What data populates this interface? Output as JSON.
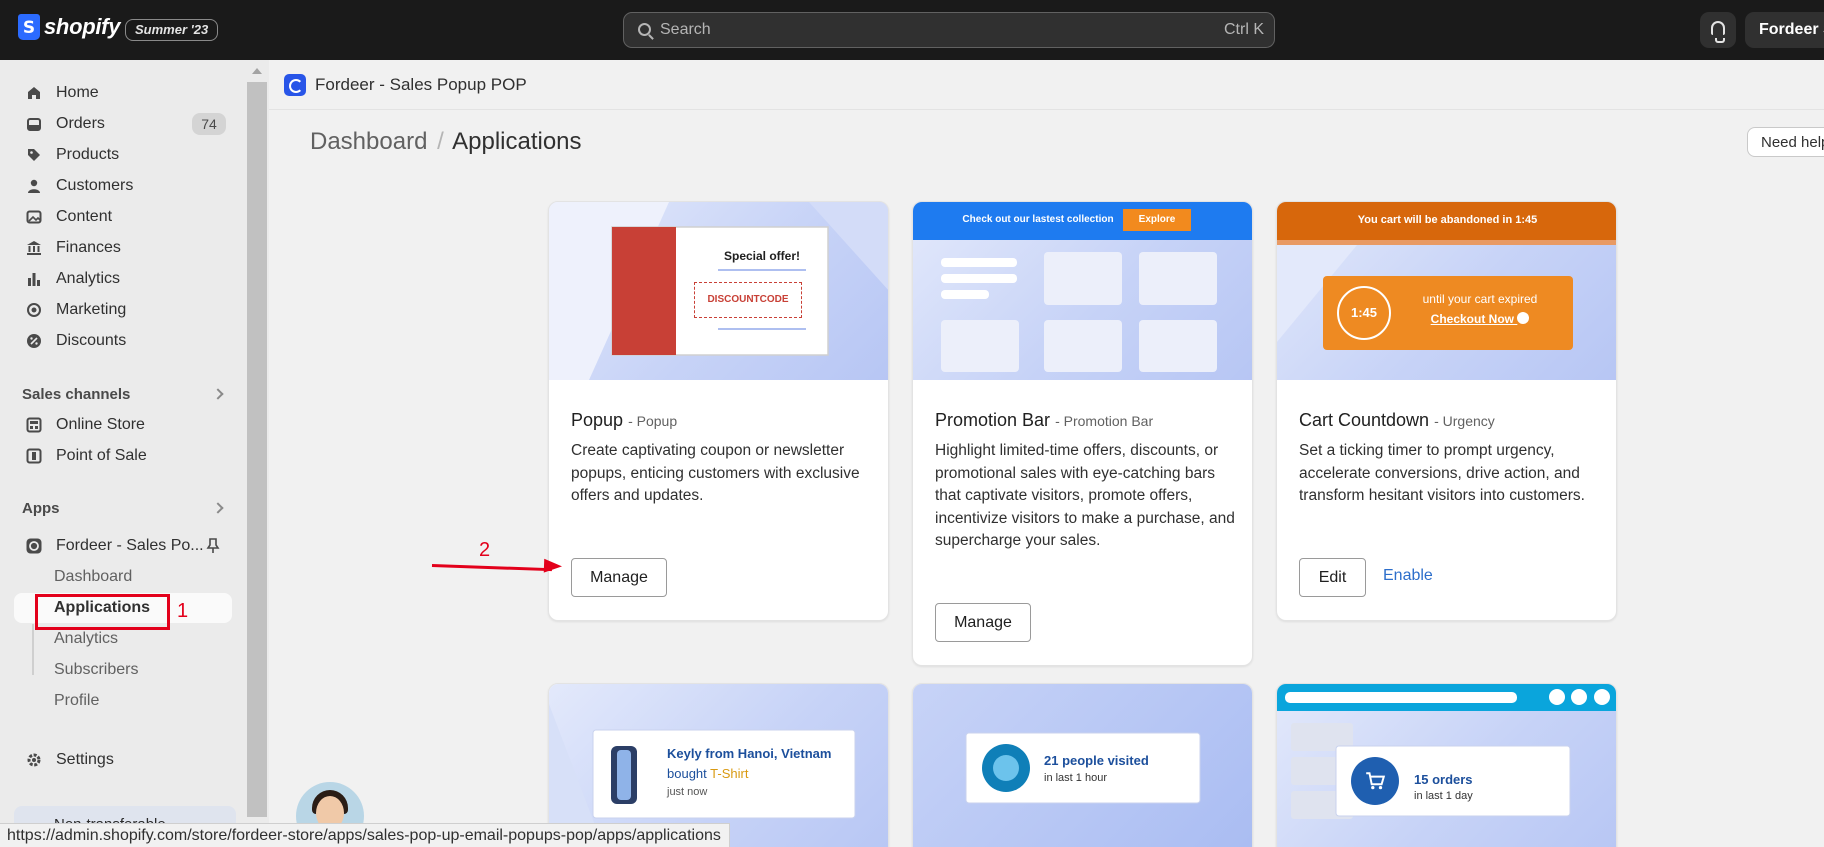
{
  "topbar": {
    "brand": "shopify",
    "brand_mark": "S",
    "edition_badge": "Summer '23",
    "search_placeholder": "Search",
    "search_shortcut": "Ctrl K",
    "store_button": "Fordeer St"
  },
  "sidebar": {
    "items": [
      {
        "label": "Home",
        "icon": "home-icon"
      },
      {
        "label": "Orders",
        "icon": "orders-icon",
        "count": "74"
      },
      {
        "label": "Products",
        "icon": "tag-icon"
      },
      {
        "label": "Customers",
        "icon": "person-icon"
      },
      {
        "label": "Content",
        "icon": "image-icon"
      },
      {
        "label": "Finances",
        "icon": "bank-icon"
      },
      {
        "label": "Analytics",
        "icon": "bar-chart-icon"
      },
      {
        "label": "Marketing",
        "icon": "target-icon"
      },
      {
        "label": "Discounts",
        "icon": "discount-icon"
      }
    ],
    "sales_channels_label": "Sales channels",
    "channels": [
      {
        "label": "Online Store",
        "icon": "store-icon"
      },
      {
        "label": "Point of Sale",
        "icon": "pos-icon"
      }
    ],
    "apps_label": "Apps",
    "app": {
      "label": "Fordeer - Sales Po...",
      "icon": "app-logo-icon"
    },
    "app_subitems": [
      "Dashboard",
      "Applications",
      "Analytics",
      "Subscribers",
      "Profile"
    ],
    "settings_label": "Settings",
    "footer_notice": "Non-transferable"
  },
  "annotations": {
    "marker_1": "1",
    "marker_2": "2"
  },
  "app_header": {
    "title": "Fordeer - Sales Popup POP"
  },
  "main": {
    "breadcrumb_root": "Dashboard",
    "breadcrumb_separator": "/",
    "breadcrumb_current": "Applications",
    "help_button": "Need help"
  },
  "cards": [
    {
      "title": "Popup",
      "tag": "- Popup",
      "description": "Create captivating coupon or newsletter popups, enticing customers with exclusive offers and updates.",
      "primary_button": "Manage",
      "banner": {
        "heading": "Special offer!",
        "code": "DISCOUNTCODE"
      }
    },
    {
      "title": "Promotion Bar",
      "tag": "- Promotion Bar",
      "description": "Highlight limited-time offers, discounts, or promotional sales with eye-catching bars that captivate visitors, promote offers, incentivize visitors to make a purchase, and supercharge your sales.",
      "primary_button": "Manage",
      "banner": {
        "bar_text": "Check out our lastest collection",
        "bar_button": "Explore"
      }
    },
    {
      "title": "Cart Countdown",
      "tag": "- Urgency",
      "description": "Set a ticking timer to prompt urgency, accelerate conversions, drive action, and transform hesitant visitors into customers.",
      "primary_button": "Edit",
      "secondary_link": "Enable",
      "banner": {
        "bar_text": "You cart will be abandoned in 1:45",
        "timer": "1:45",
        "line1": "until your cart expired",
        "cta": "Checkout Now"
      }
    }
  ],
  "preview_cards": [
    {
      "name": "Keyly from Hanoi, Vietnam",
      "action": "bought",
      "product": "T-Shirt",
      "time": "just now"
    },
    {
      "headline": "21 people visited",
      "sub": "in last 1 hour"
    },
    {
      "headline": "15 orders",
      "sub": "in last 1 day"
    }
  ],
  "status_bar_url": "https://admin.shopify.com/store/fordeer-store/apps/sales-pop-up-email-popups-pop/apps/applications",
  "colors": {
    "accent_red": "#e3001b",
    "link_blue": "#2c6ecb",
    "promo_blue": "#1e7bf0",
    "countdown_orange": "#d7670c"
  }
}
